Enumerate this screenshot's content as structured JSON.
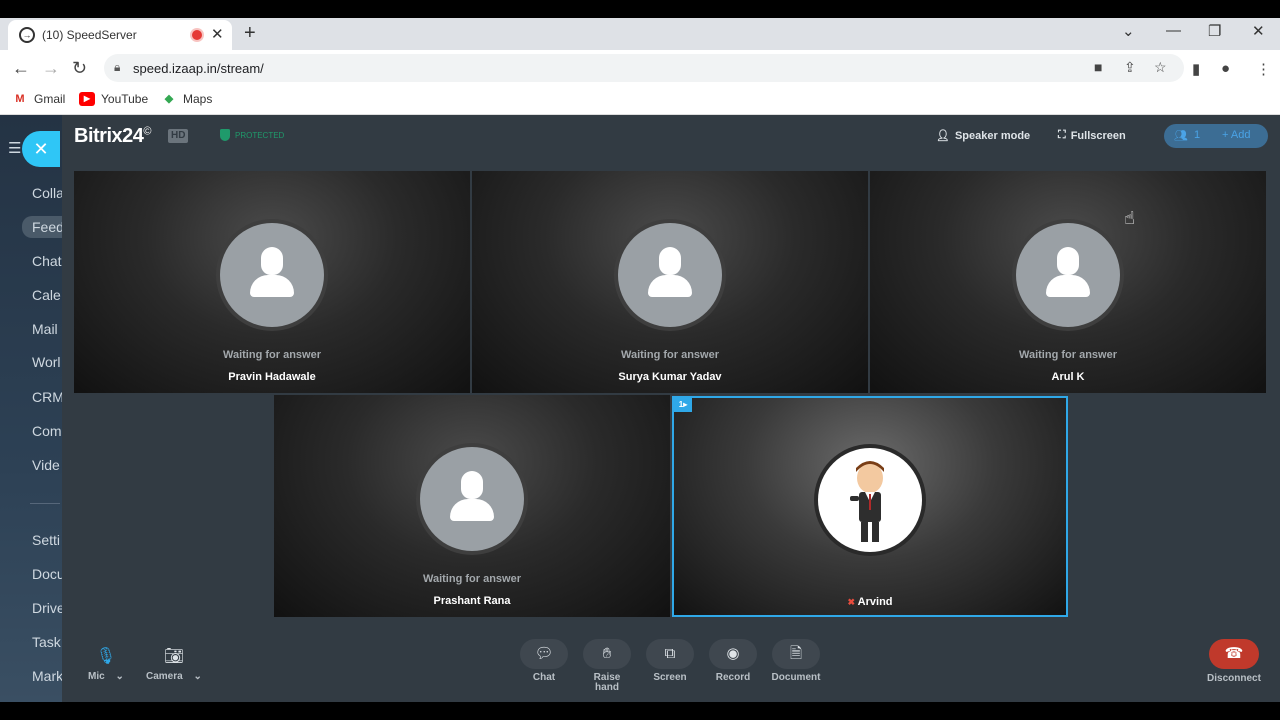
{
  "browser": {
    "tab_title": "(10) SpeedServer",
    "tab_close": "✕",
    "new_tab": "+",
    "url": "speed.izaap.in/stream/",
    "bookmarks": [
      {
        "label": "Gmail",
        "icon": "gmail-icon"
      },
      {
        "label": "YouTube",
        "icon": "youtube-icon"
      },
      {
        "label": "Maps",
        "icon": "maps-icon"
      }
    ]
  },
  "sidebar": {
    "items": [
      "Colla",
      "Feed",
      "Chat",
      "Cale",
      "Mail",
      "Worl",
      "CRM",
      "Com",
      "Vide",
      "Setti",
      "Docu",
      "Drive",
      "Task",
      "Mark"
    ],
    "active_index": 1
  },
  "call": {
    "brand": "Bitrix24",
    "brand_mark": "©",
    "hd_badge": "HD",
    "protected_label": "PROTECTED",
    "speaker_mode": "Speaker mode",
    "fullscreen": "Fullscreen",
    "user_count": "1",
    "add_label": "+ Add",
    "participants": [
      {
        "name": "Pravin Hadawale",
        "status": "Waiting for answer"
      },
      {
        "name": "Surya Kumar Yadav",
        "status": "Waiting for answer"
      },
      {
        "name": "Arul K",
        "status": "Waiting for answer"
      },
      {
        "name": "Prashant Rana",
        "status": "Waiting for answer"
      },
      {
        "name": "Arvind",
        "status": "",
        "pin": "1▸"
      }
    ],
    "controls": {
      "mic": "Mic",
      "camera": "Camera",
      "chat": "Chat",
      "raise_hand_line1": "Raise",
      "raise_hand_line2": "hand",
      "screen": "Screen",
      "record": "Record",
      "document": "Document",
      "disconnect": "Disconnect"
    }
  },
  "colors": {
    "accent": "#2fa8e8",
    "close_button": "#2fc6f6",
    "disconnect": "#c0392b",
    "protected": "#1f9a6b"
  }
}
